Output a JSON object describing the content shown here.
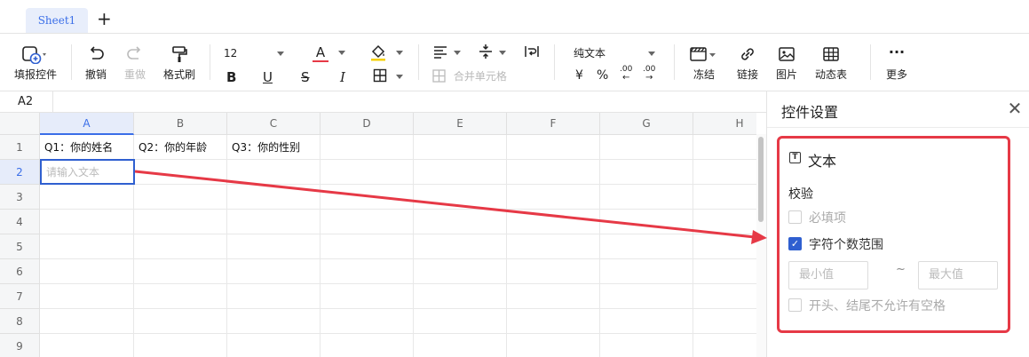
{
  "tabs": {
    "sheet_name": "Sheet1",
    "add_label": "+"
  },
  "toolbar": {
    "fill_control": "填报控件",
    "undo": "撤销",
    "redo": "重做",
    "format_painter": "格式刷",
    "font_size": "12",
    "bold": "B",
    "underline": "U",
    "strikethrough": "S",
    "italic": "I",
    "font_color": "A",
    "merge": "合并单元格",
    "number_format": "纯文本",
    "currency": "¥",
    "percent": "%",
    "dec_decrease": ".00",
    "dec_increase": ".00",
    "freeze": "冻结",
    "link": "链接",
    "image": "图片",
    "pivot": "动态表",
    "more": "更多",
    "more_icon": "···"
  },
  "cell_ref": "A2",
  "sheet": {
    "columns": [
      "A",
      "B",
      "C",
      "D",
      "E",
      "F",
      "G",
      "H"
    ],
    "rows": [
      "1",
      "2",
      "3",
      "4",
      "5",
      "6",
      "7",
      "8",
      "9"
    ],
    "cells": {
      "a1": "Q1：你的姓名",
      "b1": "Q2：你的年龄",
      "c1": "Q3：你的性别"
    },
    "a2_placeholder": "请输入文本"
  },
  "panel": {
    "title": "控件设置",
    "close_icon": "✕",
    "control_type": "文本",
    "type_icon": "T",
    "validation_title": "校验",
    "required": {
      "label": "必填项",
      "checked": false
    },
    "char_range": {
      "label": "字符个数范围",
      "checked": true
    },
    "min_placeholder": "最小值",
    "max_placeholder": "最大值",
    "tilde": "~",
    "no_space": {
      "label": "开头、结尾不允许有空格",
      "checked": false
    },
    "check_mark": "✓"
  },
  "colors": {
    "accent": "#2f5fd0",
    "highlight": "#e63946",
    "arrow": "#e63946"
  }
}
